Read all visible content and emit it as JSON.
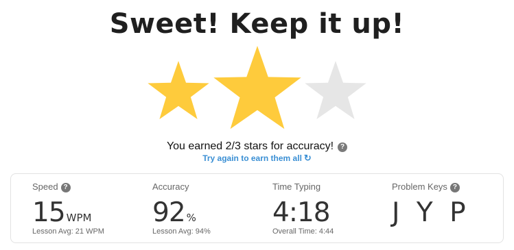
{
  "headline": "Sweet! Keep it up!",
  "stars": {
    "earned": 2,
    "total": 3,
    "filled_color": "#FECB3C",
    "empty_color": "#E6E6E6",
    "message": "You earned 2/3 stars for accuracy!",
    "help_icon": "question-circle-icon",
    "try_again_label": "Try again to earn them all",
    "retry_icon": "↻"
  },
  "stats": {
    "speed": {
      "label": "Speed",
      "value": "15",
      "unit": "WPM",
      "sub": "Lesson Avg: 21 WPM"
    },
    "accuracy": {
      "label": "Accuracy",
      "value": "92",
      "unit": "%",
      "sub": "Lesson Avg: 94%"
    },
    "time": {
      "label": "Time Typing",
      "value": "4:18",
      "sub": "Overall Time: 4:44"
    },
    "problem_keys": {
      "label": "Problem Keys",
      "value": "J Y P"
    }
  }
}
